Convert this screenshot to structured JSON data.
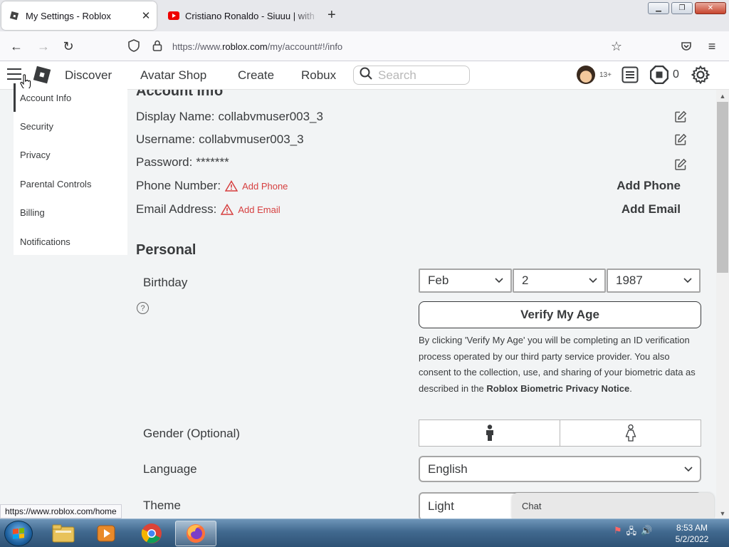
{
  "browser": {
    "tabs": [
      {
        "title": "My Settings - Roblox",
        "active": true
      },
      {
        "title": "Cristiano Ronaldo - Siuuu | with",
        "active": false
      }
    ],
    "url_prefix": "https://www.",
    "url_domain": "roblox.com",
    "url_path": "/my/account#!/info",
    "status_url": "https://www.roblox.com/home"
  },
  "header": {
    "nav": [
      "Discover",
      "Avatar Shop",
      "Create",
      "Robux"
    ],
    "search_placeholder": "Search",
    "age_badge": "13+",
    "robux_balance": "0"
  },
  "sidebar": {
    "items": [
      {
        "label": "Account Info",
        "active": true
      },
      {
        "label": "Security"
      },
      {
        "label": "Privacy"
      },
      {
        "label": "Parental Controls"
      },
      {
        "label": "Billing"
      },
      {
        "label": "Notifications"
      }
    ]
  },
  "account_info": {
    "title": "Account Info",
    "display_name_label": "Display Name:",
    "display_name": "collabvmuser003_3",
    "username_label": "Username:",
    "username": "collabvmuser003_3",
    "password_label": "Password:",
    "password": "*******",
    "phone_label": "Phone Number:",
    "phone_warning": "Add Phone",
    "phone_action": "Add Phone",
    "email_label": "Email Address:",
    "email_warning": "Add Email",
    "email_action": "Add Email"
  },
  "personal": {
    "title": "Personal",
    "birthday_label": "Birthday",
    "birth_month": "Feb",
    "birth_day": "2",
    "birth_year": "1987",
    "verify_button": "Verify My Age",
    "legal_text": "By clicking 'Verify My Age' you will be completing an ID verification process operated by our third party service provider. You also consent to the collection, use, and sharing of your biometric data as described in the",
    "legal_link": "Roblox Biometric Privacy Notice",
    "legal_end": ".",
    "gender_label": "Gender (Optional)",
    "language_label": "Language",
    "language_value": "English",
    "theme_label": "Theme",
    "theme_value": "Light"
  },
  "chat": {
    "label": "Chat"
  },
  "taskbar": {
    "time": "8:53 AM",
    "date": "5/2/2022"
  }
}
